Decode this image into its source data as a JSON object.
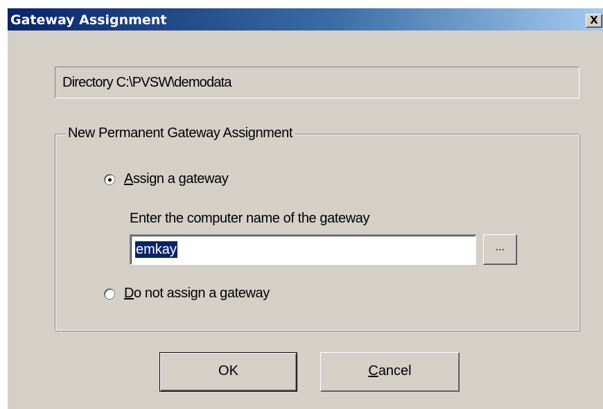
{
  "window": {
    "title": "Gateway Assignment",
    "close_label": "X"
  },
  "directory": {
    "text": "Directory C:\\PVSW\\demodata"
  },
  "group": {
    "legend": "New Permanent Gateway Assignment",
    "assign_option": {
      "mnemonic": "A",
      "label_rest": "ssign a gateway",
      "selected": true
    },
    "instruction": "Enter the computer name of the gateway",
    "gateway_name": {
      "value": "emkay",
      "selected_text": true
    },
    "browse_label": "...",
    "no_assign_option": {
      "mnemonic": "D",
      "label_rest": "o not assign a gateway",
      "selected": false
    }
  },
  "buttons": {
    "ok_label": "OK",
    "cancel_mnemonic": "C",
    "cancel_rest": "ancel"
  },
  "colors": {
    "titlebar_start": "#0a246a",
    "titlebar_end": "#a6caf0",
    "dialog_face": "#d4d0c8",
    "selection": "#0a246a"
  }
}
